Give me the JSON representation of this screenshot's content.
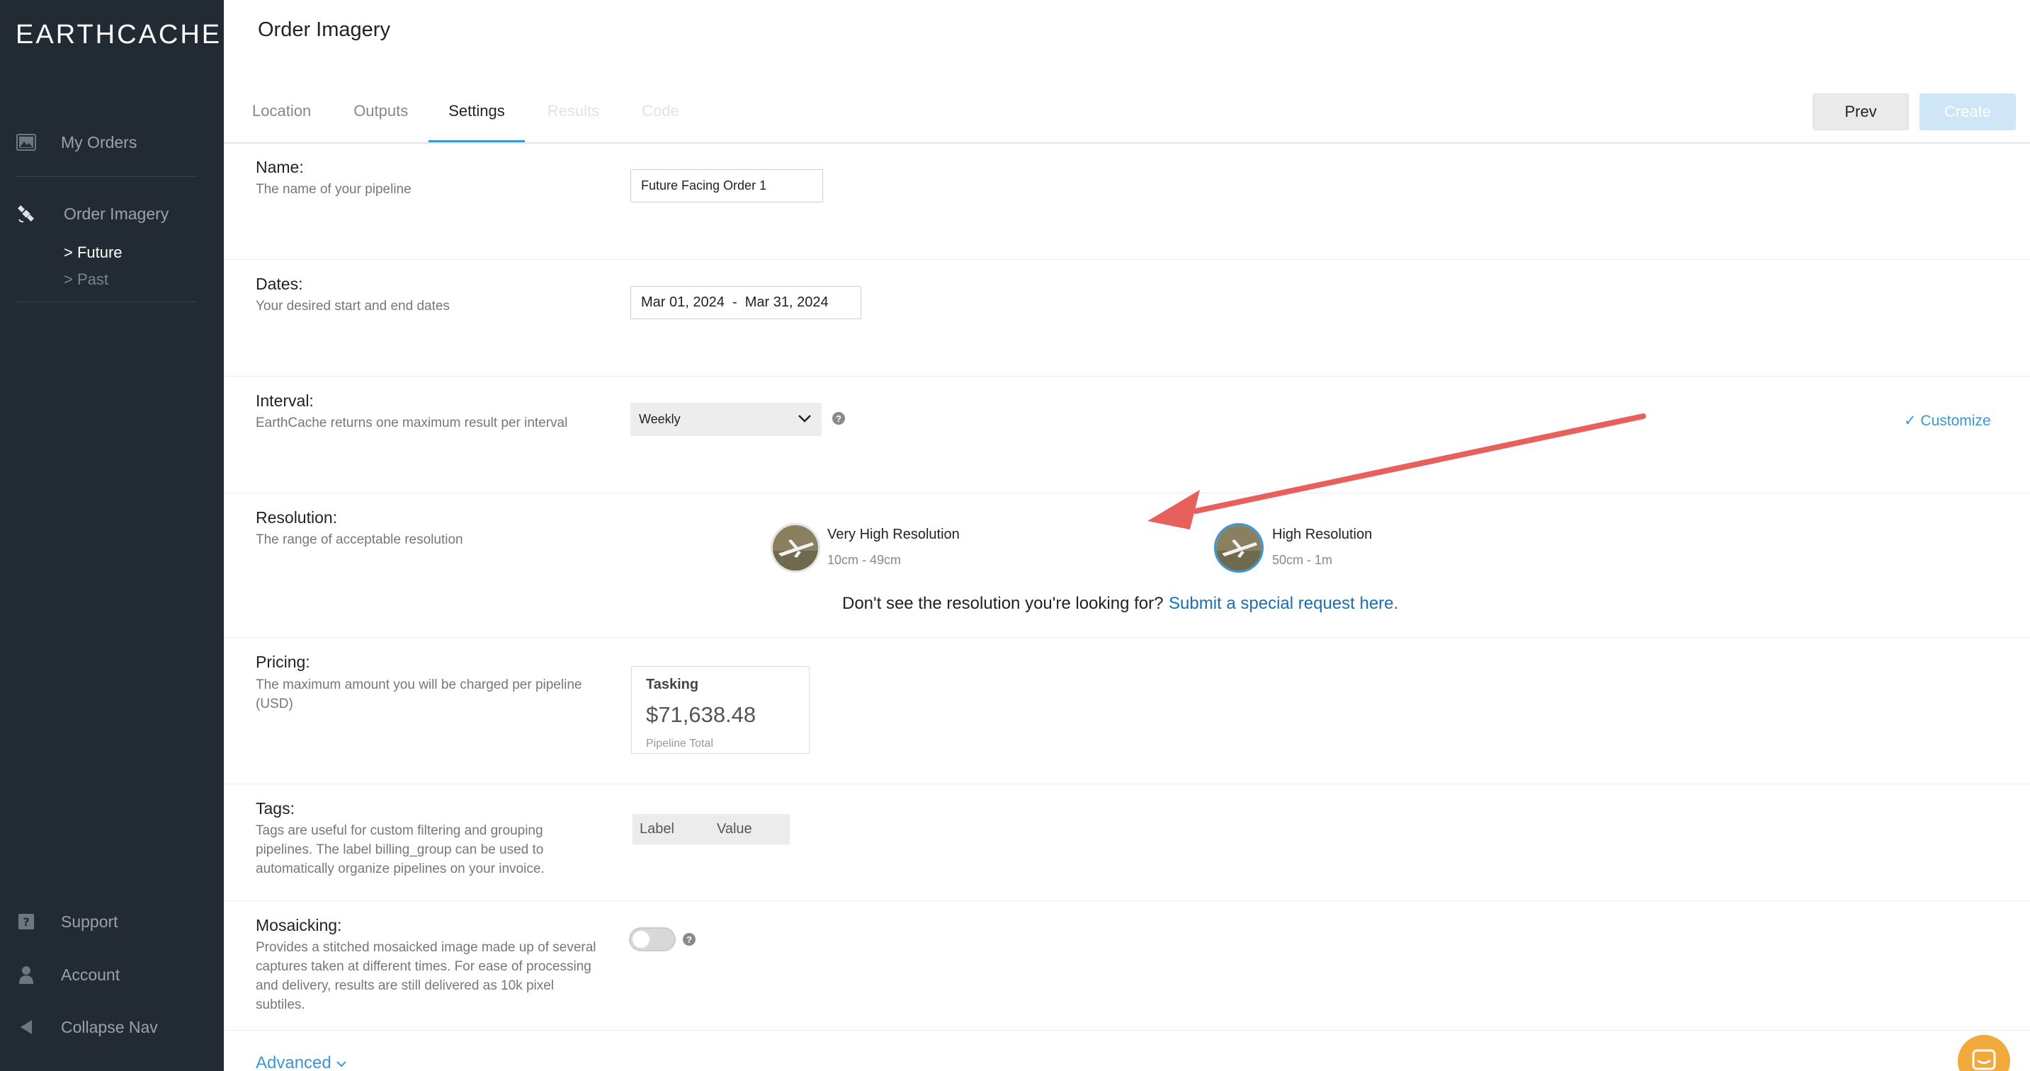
{
  "sidebar": {
    "logo": "EARTHCACHE",
    "nav_top": [
      {
        "label": "My Orders",
        "icon": "image-icon"
      },
      {
        "label": "Order Imagery",
        "icon": "satellite-icon"
      }
    ],
    "subnav": [
      {
        "label": "> Future",
        "active": true
      },
      {
        "label": "> Past",
        "active": false
      }
    ],
    "nav_bottom": [
      {
        "label": "Support",
        "icon": "help-icon"
      },
      {
        "label": "Account",
        "icon": "user-icon"
      },
      {
        "label": "Collapse Nav",
        "icon": "collapse-icon"
      }
    ]
  },
  "header": {
    "title": "Order Imagery",
    "tabs": [
      {
        "label": "Location",
        "state": "inactive"
      },
      {
        "label": "Outputs",
        "state": "inactive"
      },
      {
        "label": "Settings",
        "state": "active"
      },
      {
        "label": "Results",
        "state": "disabled"
      },
      {
        "label": "Code",
        "state": "disabled"
      }
    ],
    "prev_label": "Prev",
    "create_label": "Create"
  },
  "name": {
    "label": "Name:",
    "desc": "The name of your pipeline",
    "value": "Future Facing Order 1"
  },
  "dates": {
    "label": "Dates:",
    "desc": "Your desired start and end dates",
    "value": "Mar 01, 2024  -  Mar 31, 2024"
  },
  "interval": {
    "label": "Interval:",
    "desc": "EarthCache returns one maximum result per interval",
    "value": "Weekly",
    "customize": "✓ Customize"
  },
  "resolution": {
    "label": "Resolution:",
    "desc": "The range of acceptable resolution",
    "options": [
      {
        "title": "Very High Resolution",
        "range": "10cm - 49cm",
        "selected": false
      },
      {
        "title": "High Resolution",
        "range": "50cm - 1m",
        "selected": true
      }
    ],
    "prompt": "Don't see the resolution you're looking for?",
    "link": "Submit a special request here."
  },
  "pricing": {
    "label": "Pricing:",
    "desc": "The maximum amount you will be charged per pipeline (USD)",
    "card_title": "Tasking",
    "amount": "$71,638.48",
    "sub": "Pipeline Total"
  },
  "tags": {
    "label": "Tags:",
    "desc": "Tags are useful for custom filtering and grouping pipelines. The label billing_group can be used to automatically organize pipelines on your invoice.",
    "col_label": "Label",
    "col_value": "Value"
  },
  "mosaicking": {
    "label": "Mosaicking:",
    "desc": "Provides a stitched mosaicked image made up of several captures taken at different times. For ease of processing and delivery, results are still delivered as 10k pixel subtiles.",
    "enabled": false
  },
  "advanced": "Advanced",
  "colors": {
    "sidebar_bg": "#222b33",
    "accent": "#3b96d4",
    "arrow": "#e8605b",
    "chat": "#f2a93b"
  }
}
